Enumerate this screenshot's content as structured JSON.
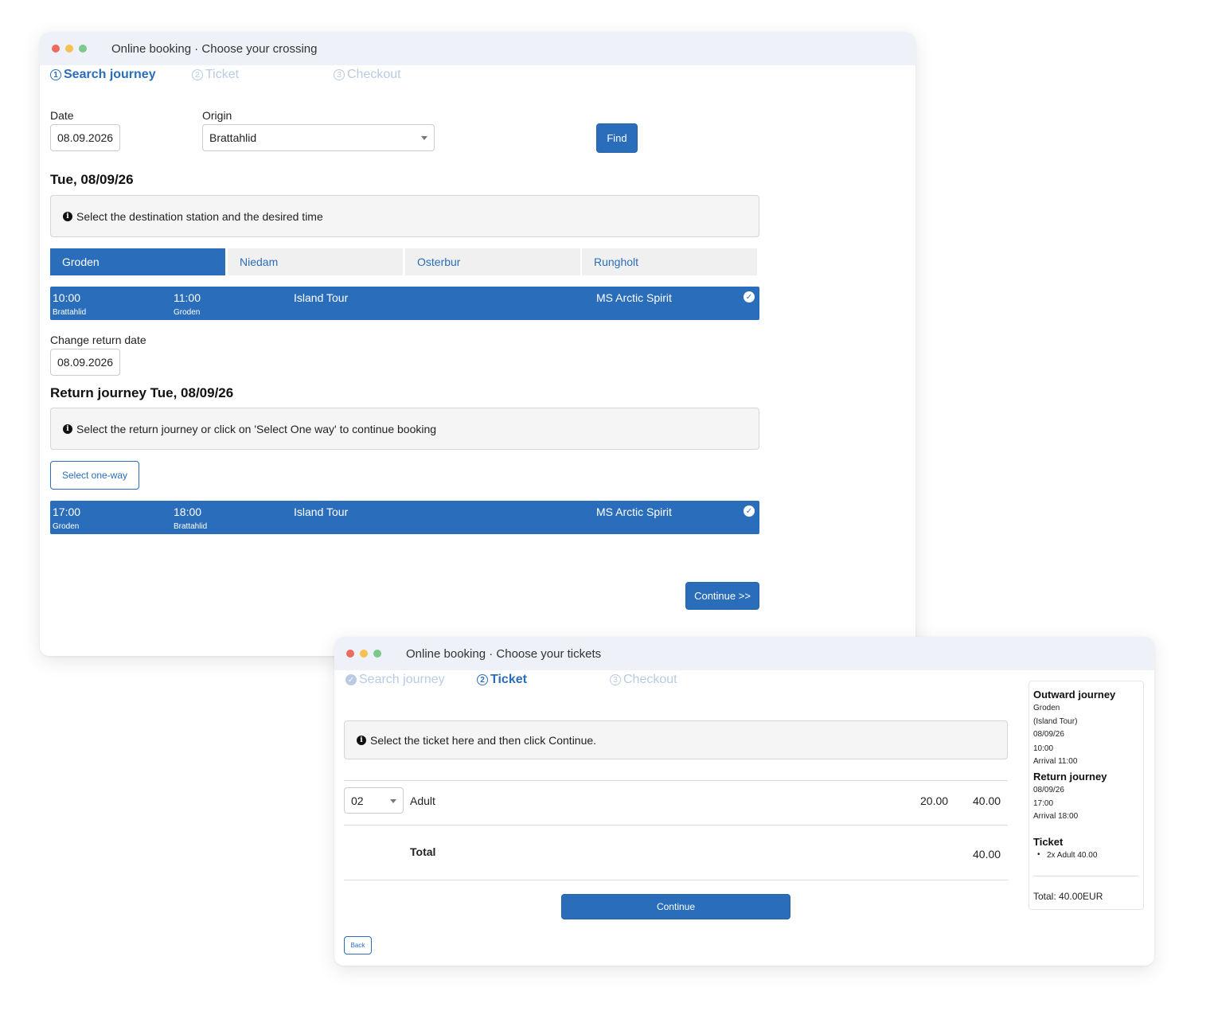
{
  "window1": {
    "title": "Online booking · Choose your crossing",
    "steps": [
      {
        "num": "1",
        "label": "Search journey"
      },
      {
        "num": "2",
        "label": "Ticket"
      },
      {
        "num": "3",
        "label": "Checkout"
      }
    ],
    "date_label": "Date",
    "date_value": "08.09.2026",
    "origin_label": "Origin",
    "origin_value": "Brattahlid",
    "find_label": "Find",
    "outward_heading": "Tue, 08/09/26",
    "outward_alert": "Select the destination station and the desired time",
    "tabs": [
      "Groden",
      "Niedam",
      "Osterbur",
      "Rungholt"
    ],
    "outward_trip": {
      "dep_time": "10:00",
      "dep_station": "Brattahlid",
      "arr_time": "11:00",
      "arr_station": "Groden",
      "route": "Island Tour",
      "ship": "MS Arctic Spirit"
    },
    "return_date_label": "Change return date",
    "return_date_value": "08.09.2026",
    "return_heading": "Return journey Tue, 08/09/26",
    "return_alert": "Select the return journey or click on 'Select One way' to continue booking",
    "one_way_label": "Select one-way",
    "return_trip": {
      "dep_time": "17:00",
      "dep_station": "Groden",
      "arr_time": "18:00",
      "arr_station": "Brattahlid",
      "route": "Island Tour",
      "ship": "MS Arctic Spirit"
    },
    "continue_label": "Continue >>"
  },
  "window2": {
    "title": "Online booking · Choose your tickets",
    "steps": [
      {
        "num": "✓",
        "label": "Search journey"
      },
      {
        "num": "2",
        "label": "Ticket"
      },
      {
        "num": "3",
        "label": "Checkout"
      }
    ],
    "alert": "Select the ticket here and then click Continue.",
    "ticket_row": {
      "qty": "02",
      "type": "Adult",
      "unit_price": "20.00",
      "line_total": "40.00"
    },
    "total_label": "Total",
    "total_value": "40.00",
    "continue_label": "Continue",
    "back_label": "Back",
    "summary": {
      "outward_heading": "Outward journey",
      "outward_lines": [
        "Groden",
        "(Island Tour)",
        "08/09/26",
        "10:00",
        "Arrival 11:00"
      ],
      "return_heading": "Return journey",
      "return_lines": [
        "08/09/26",
        "17:00",
        "Arrival 18:00"
      ],
      "ticket_heading": "Ticket",
      "ticket_item": "2x Adult 40.00",
      "total": "Total: 40.00EUR"
    }
  },
  "colors": {
    "accent": "#2a6ebb",
    "titlebar": "#eef2f8",
    "dot_red": "#ee6a5f",
    "dot_yellow": "#f5c04f",
    "dot_green": "#7bc98c"
  }
}
